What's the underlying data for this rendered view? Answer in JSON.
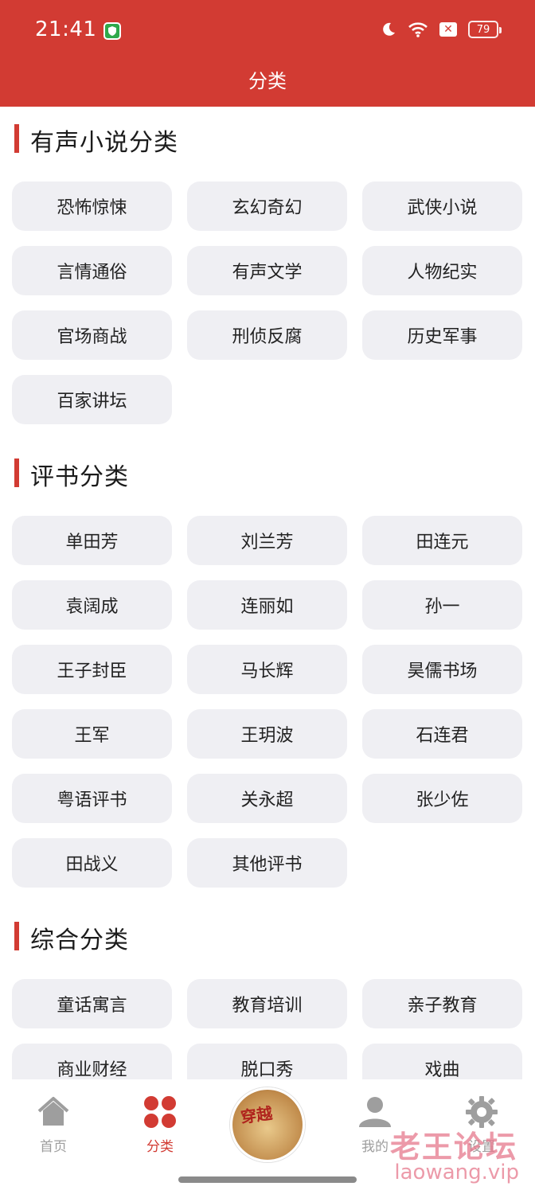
{
  "status_bar": {
    "time": "21:41",
    "battery": "79"
  },
  "header": {
    "title": "分类"
  },
  "sections": [
    {
      "title": "有声小说分类",
      "items": [
        "恐怖惊悚",
        "玄幻奇幻",
        "武侠小说",
        "言情通俗",
        "有声文学",
        "人物纪实",
        "官场商战",
        "刑侦反腐",
        "历史军事",
        "百家讲坛"
      ]
    },
    {
      "title": "评书分类",
      "items": [
        "单田芳",
        "刘兰芳",
        "田连元",
        "袁阔成",
        "连丽如",
        "孙一",
        "王子封臣",
        "马长辉",
        "昊儒书场",
        "王军",
        "王玥波",
        "石连君",
        "粤语评书",
        "关永超",
        "张少佐",
        "田战义",
        "其他评书"
      ]
    },
    {
      "title": "综合分类",
      "items": [
        "童话寓言",
        "教育培训",
        "亲子教育",
        "商业财经",
        "脱口秀",
        "戏曲"
      ]
    }
  ],
  "tabbar": {
    "home": "首页",
    "category": "分类",
    "center_art_text": "穿越",
    "mine": "我的",
    "settings": "设置"
  },
  "watermark": {
    "cn": "老王论坛",
    "en": "laowang.vip"
  },
  "colors": {
    "accent": "#d23b33",
    "chip_bg": "#efeff3"
  }
}
